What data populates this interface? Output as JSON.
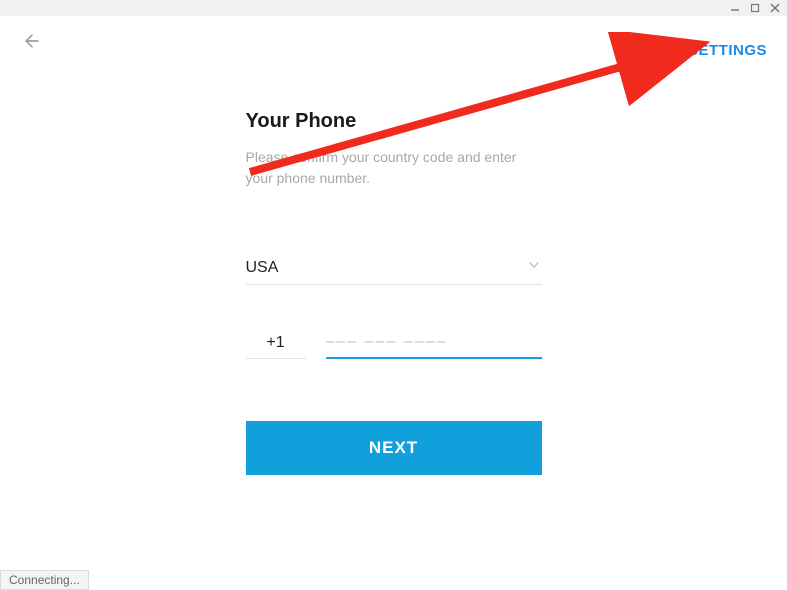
{
  "topbar": {
    "settings_label": "SETTINGS"
  },
  "page": {
    "title": "Your Phone",
    "subtitle": "Please confirm your country code and enter your phone number."
  },
  "form": {
    "country": "USA",
    "country_code": "+1",
    "phone_placeholder": "––– ––– ––––",
    "next_label": "NEXT"
  },
  "status": {
    "text": "Connecting..."
  },
  "colors": {
    "accent": "#11a0dc",
    "link": "#1e88e5",
    "annotation": "#f02b1d"
  }
}
